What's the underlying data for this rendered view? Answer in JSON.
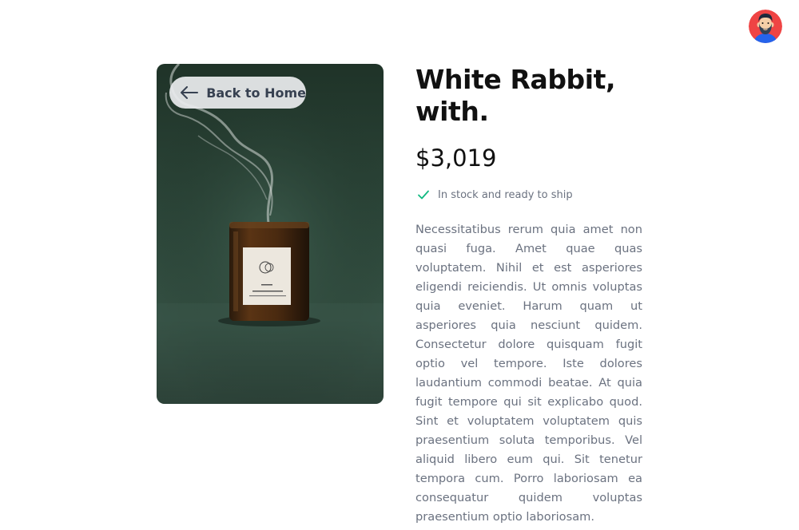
{
  "header": {
    "avatar_icon": "bearded-man-avatar-icon"
  },
  "product": {
    "back_label": "Back to Home",
    "back_icon": "arrow-left-icon",
    "image_alt": "candle-photo",
    "label_text_line1": "HOLY SMOKE",
    "title": "White Rabbit, with.",
    "price": "$3,019",
    "stock_icon": "check-icon",
    "stock_text": "In stock and ready to ship",
    "description": "Necessitatibus rerum quia amet non quasi fuga. Amet quae quas voluptatem. Nihil et est asperiores eligendi reiciendis. Ut omnis voluptas quia eveniet. Harum quam ut asperiores quia nesciunt quidem. Consectetur dolore quisquam fugit optio vel tempore. Iste dolores laudantium commodi beatae. At quia fugit tempore qui sit explicabo quod. Sint et voluptatem voluptatem quis praesentium soluta temporibus. Vel aliquid libero eum qui. Sit tenetur tempora cum. Porro laboriosam ea consequatur quidem voluptas praesentium optio laboriosam."
  },
  "colors": {
    "accent_check": "#10b981",
    "avatar_bg": "#ef4444",
    "photo_bg": "#2f4a3d"
  }
}
